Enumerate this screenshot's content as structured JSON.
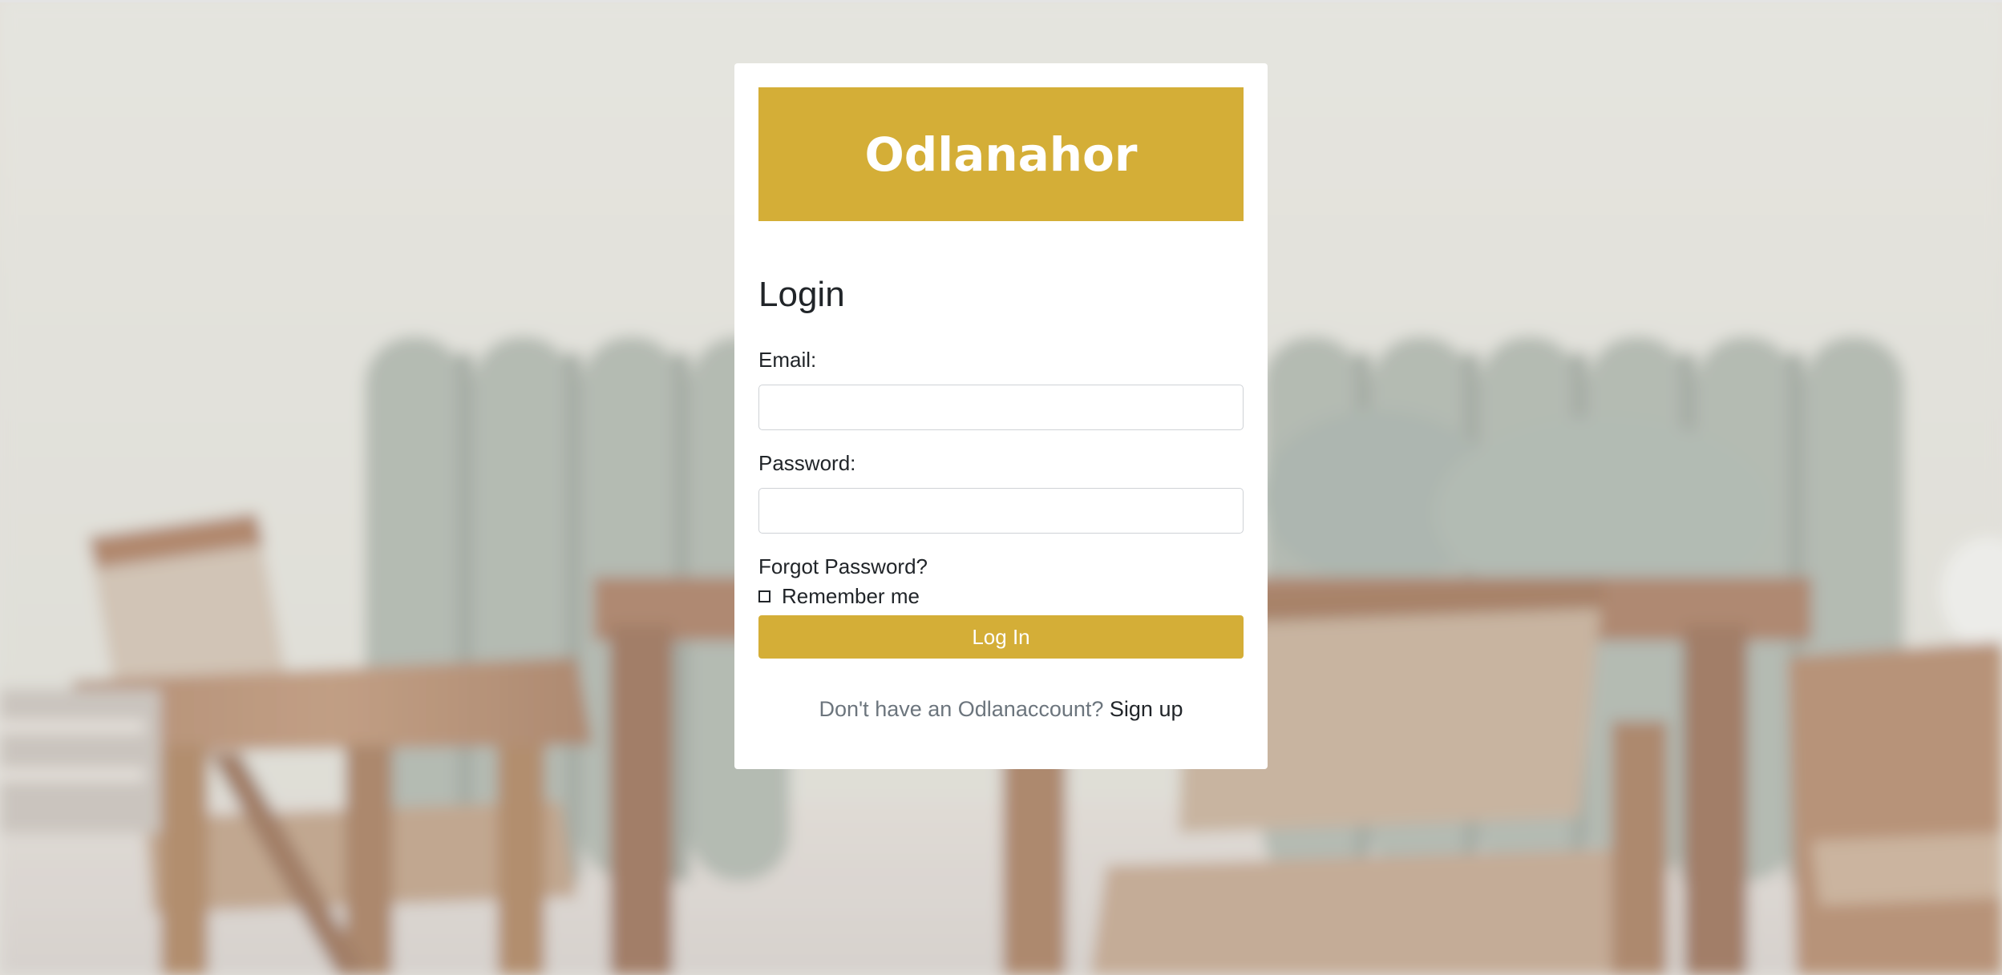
{
  "brand": {
    "name": "Odlanahor",
    "color": "#d4ae37"
  },
  "login": {
    "heading": "Login",
    "email_label": "Email:",
    "email_value": "",
    "password_label": "Password:",
    "password_value": "",
    "forgot_link": "Forgot Password?",
    "remember_label": "Remember me",
    "remember_checked": false,
    "submit_label": "Log In"
  },
  "signup": {
    "prompt": "Don't have an Odlanaccount?",
    "link": "Sign up"
  },
  "background": {
    "description_icon": "blurred-dining-room-photo"
  }
}
